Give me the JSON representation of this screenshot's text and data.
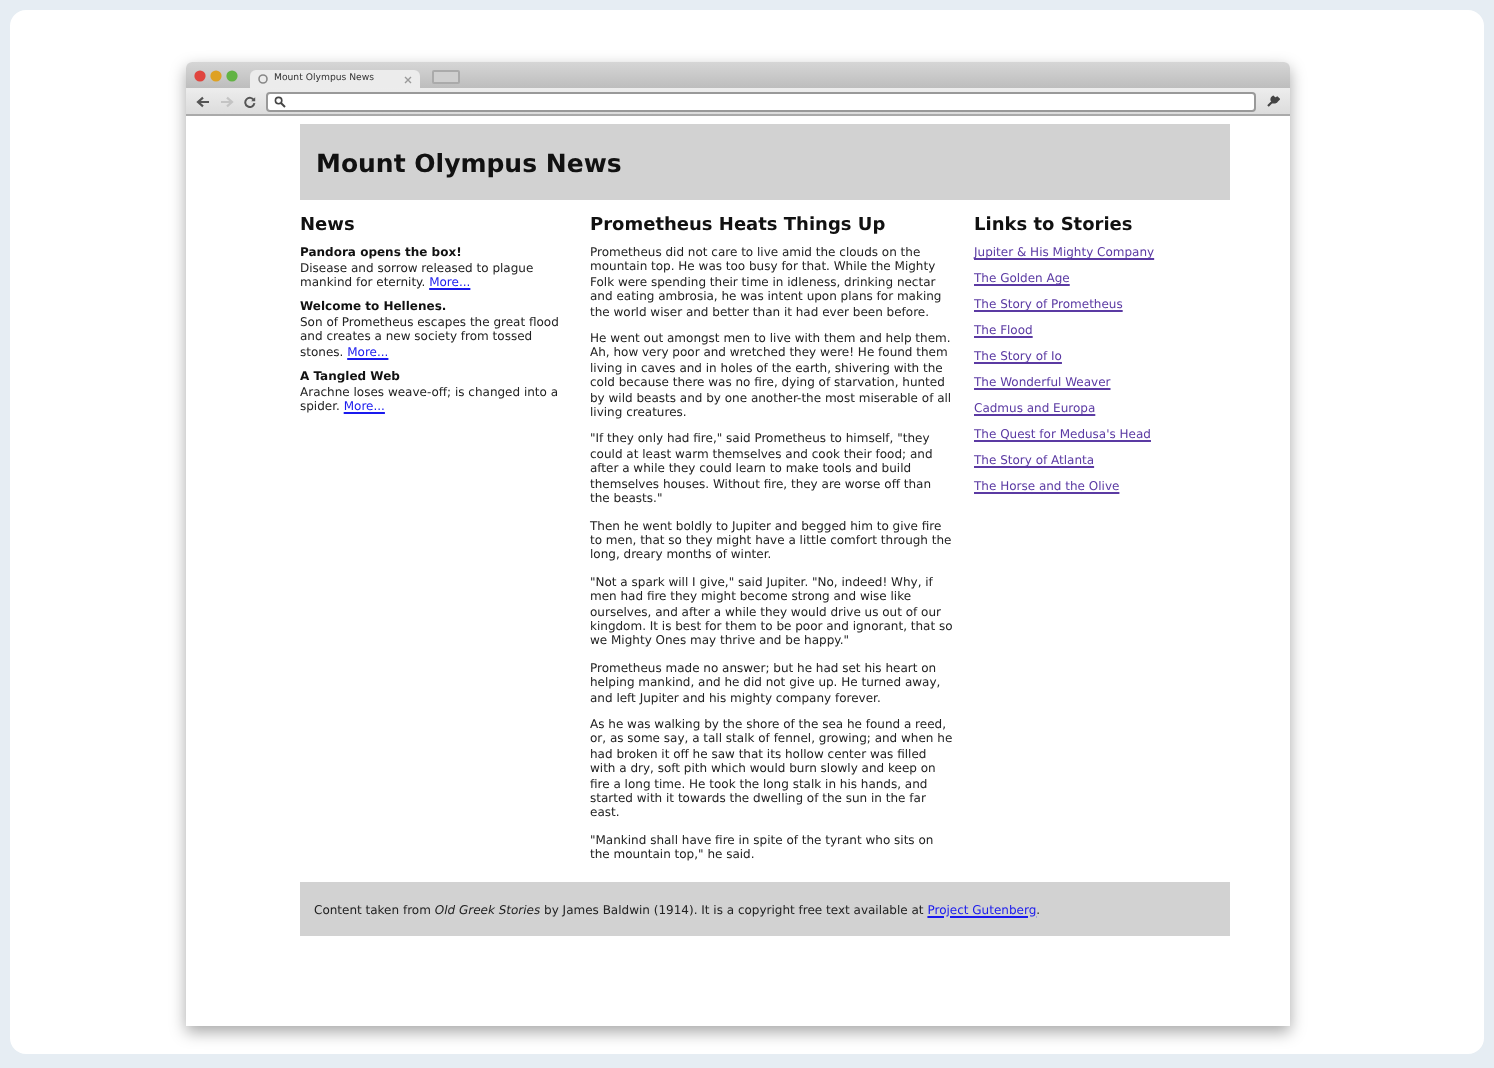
{
  "browser": {
    "tab_title": "Mount Olympus News"
  },
  "page": {
    "title": "Mount Olympus News",
    "news": {
      "heading": "News",
      "items": [
        {
          "title": "Pandora opens the box!",
          "text": "Disease and sorrow released to plague mankind for eternity.",
          "link": "More..."
        },
        {
          "title": "Welcome to Hellenes.",
          "text": "Son of Prometheus escapes the great flood and creates a new society from tossed stones.",
          "link": "More..."
        },
        {
          "title": "A Tangled Web",
          "text": "Arachne loses weave-off; is changed into a spider.",
          "link": "More..."
        }
      ]
    },
    "article": {
      "heading": "Prometheus Heats Things Up",
      "paragraphs": [
        "Prometheus did not care to live amid the clouds on the mountain top. He was too busy for that. While the Mighty Folk were spending their time in idleness, drinking nectar and eating ambrosia, he was intent upon plans for making the world wiser and better than it had ever been before.",
        "He went out amongst men to live with them and help them. Ah, how very poor and wretched they were! He found them living in caves and in holes of the earth, shivering with the cold because there was no fire, dying of starvation, hunted by wild beasts and by one another-the most miserable of all living creatures.",
        "\"If they only had fire,\" said Prometheus to himself, \"they could at least warm themselves and cook their food; and after a while they could learn to make tools and build themselves houses. Without fire, they are worse off than the beasts.\"",
        "Then he went boldly to Jupiter and begged him to give fire to men, that so they might have a little comfort through the long, dreary months of winter.",
        "\"Not a spark will I give,\" said Jupiter. \"No, indeed! Why, if men had fire they might become strong and wise like ourselves, and after a while they would drive us out of our kingdom. It is best for them to be poor and ignorant, that so we Mighty Ones may thrive and be happy.\"",
        "Prometheus made no answer; but he had set his heart on helping mankind, and he did not give up. He turned away, and left Jupiter and his mighty company forever.",
        "As he was walking by the shore of the sea he found a reed, or, as some say, a tall stalk of fennel, growing; and when he had broken it off he saw that its hollow center was filled with a dry, soft pith which would burn slowly and keep on fire a long time. He took the long stalk in his hands, and started with it towards the dwelling of the sun in the far east.",
        "\"Mankind shall have fire in spite of the tyrant who sits on the mountain top,\" he said."
      ]
    },
    "links": {
      "heading": "Links to Stories",
      "items": [
        "Jupiter & His Mighty Company",
        "The Golden Age",
        "The Story of Prometheus",
        "The Flood",
        "The Story of Io",
        "The Wonderful Weaver",
        "Cadmus and Europa",
        "The Quest for Medusa's Head",
        "The Story of Atlanta",
        "The Horse and the Olive"
      ]
    },
    "footer": {
      "text": "Content taken from *Old Greek Stories* by James Baldwin (1914). It is a copyright free text available at",
      "link": "Project Gutenberg",
      "after": "."
    }
  }
}
